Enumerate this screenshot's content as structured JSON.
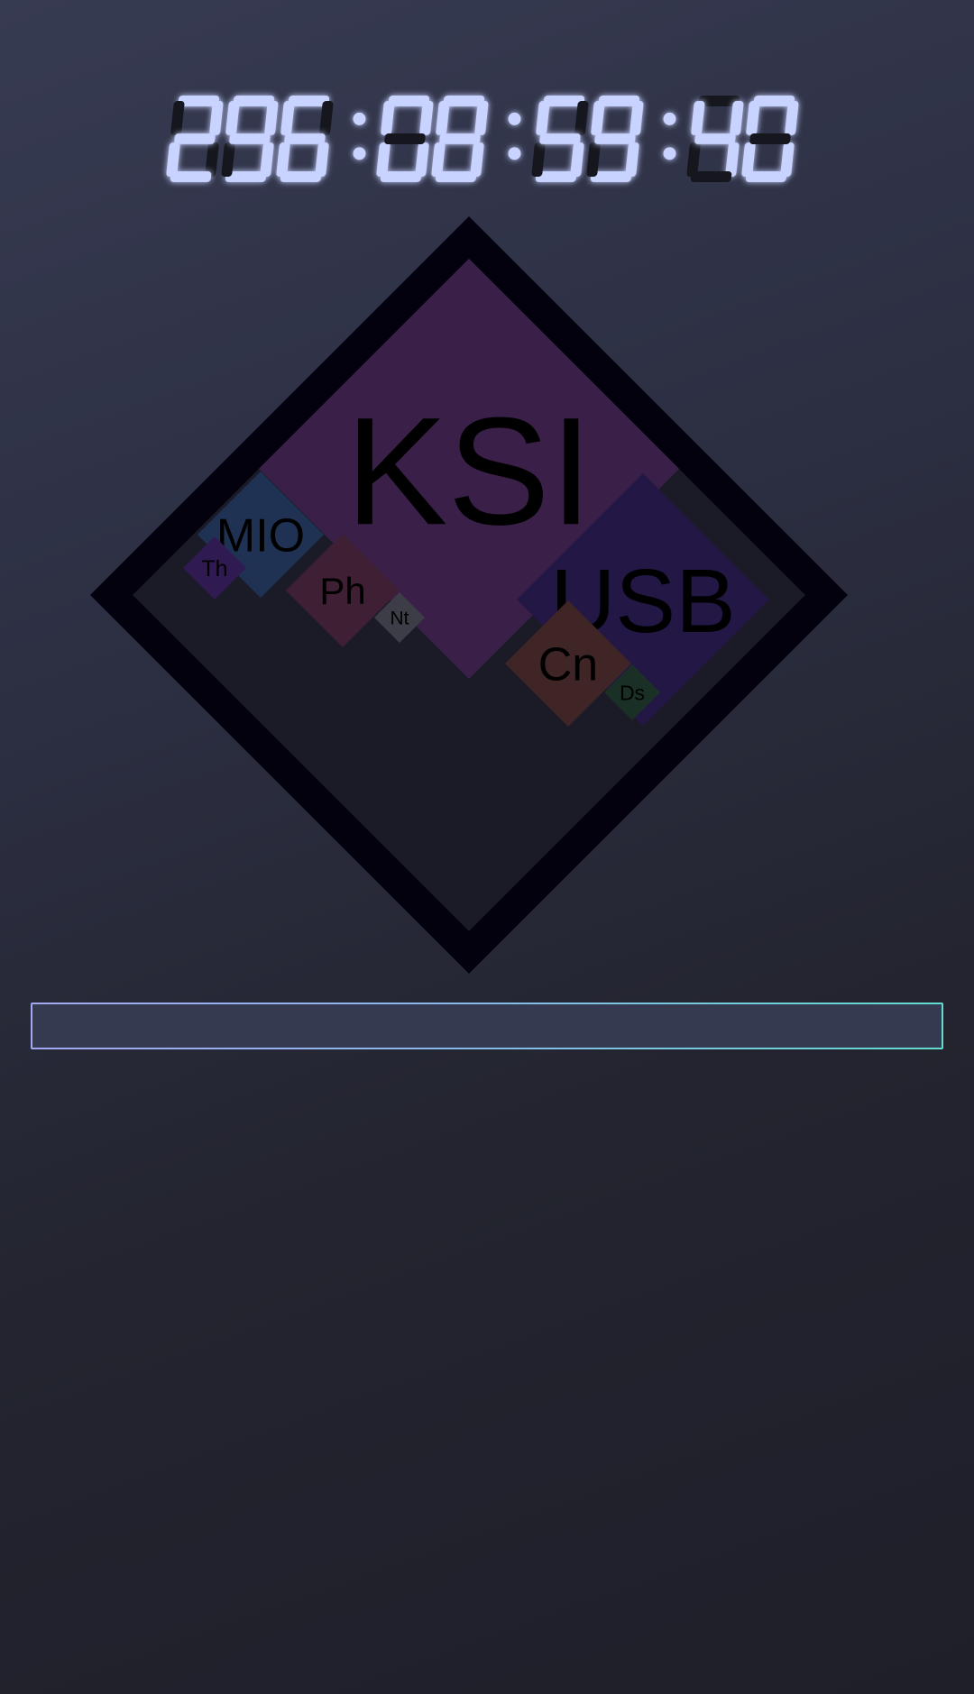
{
  "timer": {
    "groups": [
      "296",
      "08",
      "59",
      "40"
    ],
    "separator": ":",
    "lit_color": "#c9d3ff",
    "glow_color": "#8fa3ff",
    "unlit_color": "#16171e"
  },
  "board": {
    "frame_color": "#02010d",
    "empty_color": "#1a1b27",
    "pieces": [
      {
        "label": "KSI",
        "color": "#3a2049"
      },
      {
        "label": "USB",
        "color": "#231746"
      },
      {
        "label": "MIO",
        "color": "#1f3253"
      },
      {
        "label": "Th",
        "color": "#2f1a52"
      },
      {
        "label": "Ph",
        "color": "#3e1f33"
      },
      {
        "label": "Nt",
        "color": "#3c3d46"
      },
      {
        "label": "Cn",
        "color": "#3f2526"
      },
      {
        "label": "Ds",
        "color": "#1a3027"
      }
    ]
  },
  "input": {
    "value": "",
    "placeholder": ""
  }
}
